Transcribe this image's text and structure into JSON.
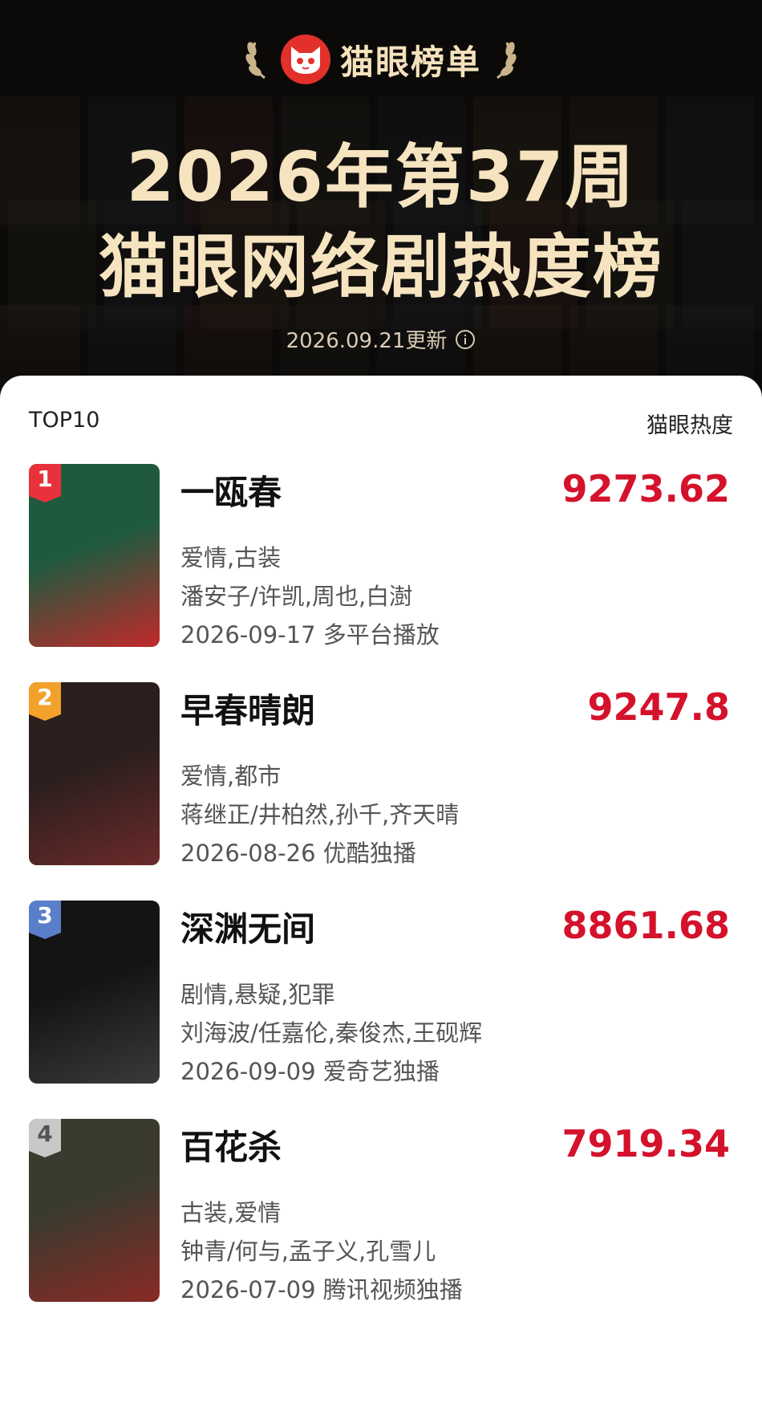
{
  "header": {
    "brand": "猫眼榜单",
    "title_line1": "2026年第37周",
    "title_line2": "猫眼网络剧热度榜",
    "update_text": "2026.09.21更新",
    "colors": {
      "title": "#f5e4bf",
      "logo_red": "#e4302b",
      "heat_red": "#d4122c"
    }
  },
  "list": {
    "left_label": "TOP10",
    "right_label": "猫眼热度",
    "items": [
      {
        "rank": "1",
        "name": "一瓯春",
        "heat": "9273.62",
        "genres": "爱情,古装",
        "cast": "潘安子/许凯,周也,白澍",
        "release": "2026-09-17 多平台播放",
        "badge_color": "#e8313b",
        "poster_colors": [
          "#1f5a3f",
          "#c02a2a"
        ]
      },
      {
        "rank": "2",
        "name": "早春晴朗",
        "heat": "9247.8",
        "genres": "爱情,都市",
        "cast": "蒋继正/井柏然,孙千,齐天晴",
        "release": "2026-08-26 优酷独播",
        "badge_color": "#f2a12a",
        "poster_colors": [
          "#2a1f1d",
          "#6b2a2a"
        ]
      },
      {
        "rank": "3",
        "name": "深渊无间",
        "heat": "8861.68",
        "genres": "剧情,悬疑,犯罪",
        "cast": "刘海波/任嘉伦,秦俊杰,王砚辉",
        "release": "2026-09-09 爱奇艺独播",
        "badge_color": "#5a7ec9",
        "poster_colors": [
          "#141414",
          "#3a3a3a"
        ]
      },
      {
        "rank": "4",
        "name": "百花杀",
        "heat": "7919.34",
        "genres": "古装,爱情",
        "cast": "钟青/何与,孟子义,孔雪儿",
        "release": "2026-07-09 腾讯视频独播",
        "badge_color": "#c8c8c8",
        "poster_colors": [
          "#3b3a2e",
          "#8a2a26"
        ]
      }
    ]
  }
}
